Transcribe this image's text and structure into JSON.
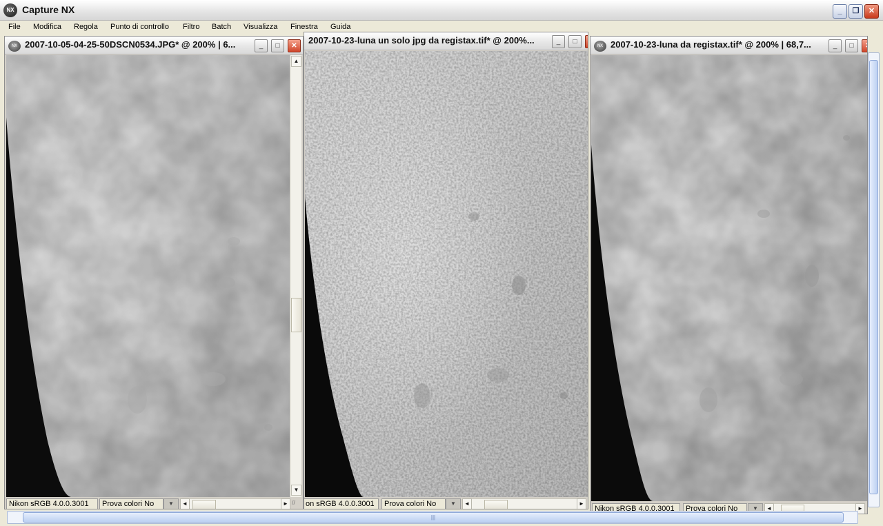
{
  "app": {
    "title": "Capture NX",
    "logo_text": "NX",
    "caption_buttons": {
      "minimize": "_",
      "restore": "❐",
      "close": "✕"
    }
  },
  "menu": {
    "items": [
      "File",
      "Modifica",
      "Regola",
      "Punto di controllo",
      "Filtro",
      "Batch",
      "Visualizza",
      "Finestra",
      "Guida"
    ]
  },
  "documents": [
    {
      "title": "2007-10-05-04-25-50DSCN0534.JPG*  @  200%  |  6...",
      "color_profile": "Nikon sRGB 4.0.0.3001",
      "proof_colors": "Prova colori No",
      "image": "moon surface, soft"
    },
    {
      "title": "2007-10-23-luna  un  solo  jpg  da  registax.tif*  @  200%...",
      "color_profile": "on sRGB 4.0.0.3001",
      "proof_colors": "Prova colori No",
      "image": "moon surface, sharpened"
    },
    {
      "title": "2007-10-23-luna  da  registax.tif*  @  200%  |  68,7...",
      "color_profile": "Nikon sRGB 4.0.0.3001",
      "proof_colors": "Prova colori No",
      "image": "moon surface, stacked"
    }
  ],
  "icons": {
    "dropdown": "▼",
    "left": "◄",
    "right": "►",
    "up": "▲",
    "down": "▼",
    "grip": "//"
  },
  "colors": {
    "window_bg": "#ece9d8",
    "close_red": "#c9391b",
    "scroll_blue": "#bcd0f2"
  }
}
